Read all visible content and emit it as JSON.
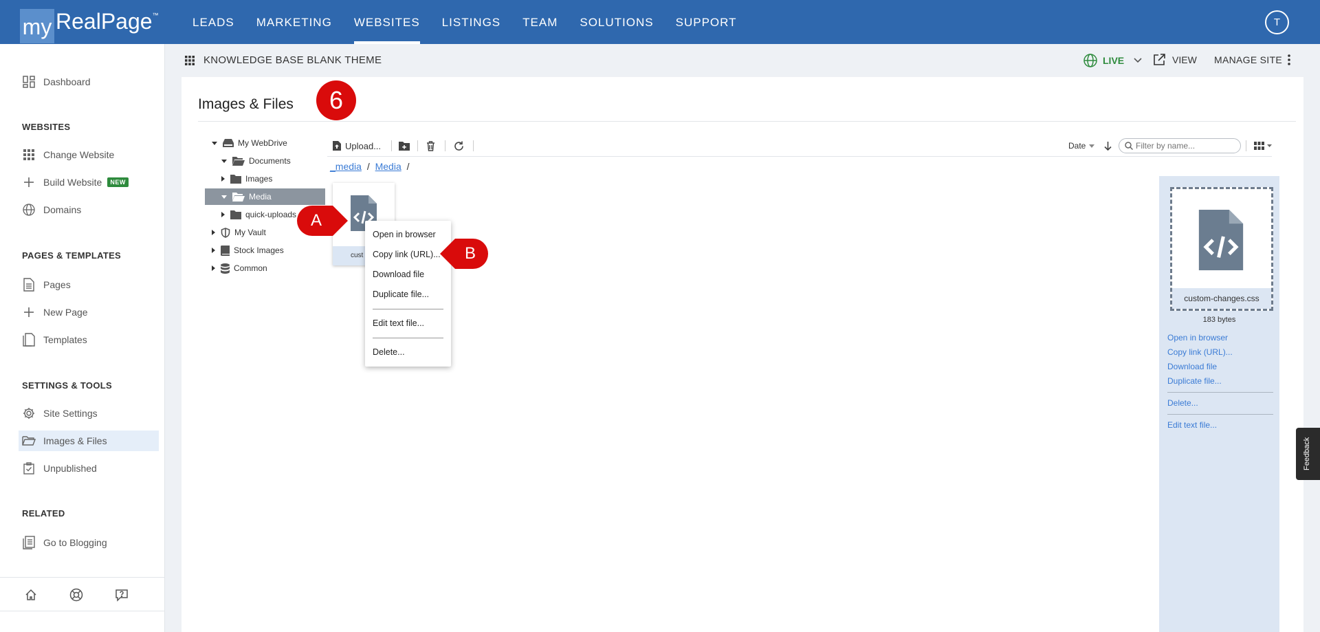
{
  "brand": {
    "logo_my": "my",
    "logo_rest": "RealPage",
    "logo_tm": "™"
  },
  "nav": {
    "items": [
      "LEADS",
      "MARKETING",
      "WEBSITES",
      "LISTINGS",
      "TEAM",
      "SOLUTIONS",
      "SUPPORT"
    ],
    "active": "WEBSITES",
    "avatar_initial": "T"
  },
  "sidebar": {
    "dashboard": "Dashboard",
    "sections": {
      "websites": "WEBSITES",
      "pages_templates": "PAGES & TEMPLATES",
      "settings_tools": "SETTINGS & TOOLS",
      "related": "RELATED"
    },
    "items": {
      "change_website": "Change Website",
      "build_website": "Build Website",
      "build_badge": "NEW",
      "domains": "Domains",
      "pages": "Pages",
      "new_page": "New Page",
      "templates": "Templates",
      "site_settings": "Site Settings",
      "images_files": "Images & Files",
      "unpublished": "Unpublished",
      "go_to_blogging": "Go to Blogging"
    }
  },
  "subheader": {
    "site_name": "KNOWLEDGE BASE BLANK THEME",
    "live": "LIVE",
    "view": "VIEW",
    "manage_site": "MANAGE SITE"
  },
  "page": {
    "title": "Images & Files",
    "step": "6"
  },
  "tree": {
    "my_webdrive": "My WebDrive",
    "documents": "Documents",
    "images": "Images",
    "media": "Media",
    "quick_uploads": "quick-uploads",
    "my_vault": "My Vault",
    "stock_images": "Stock Images",
    "common": "Common"
  },
  "toolbar": {
    "upload": "Upload...",
    "sort_label": "Date",
    "filter_placeholder": "Filter by name..."
  },
  "breadcrumb": {
    "root": "_media",
    "child": "Media",
    "sep": "/"
  },
  "file_tile": {
    "label": "cust"
  },
  "markers": {
    "a": "A",
    "b": "B"
  },
  "context_menu": {
    "open_in_browser": "Open in browser",
    "copy_link": "Copy link (URL)...",
    "download_file": "Download file",
    "duplicate_file": "Duplicate file...",
    "edit_text_file": "Edit text file...",
    "delete": "Delete..."
  },
  "details": {
    "file_name": "custom-changes.css",
    "size": "183 bytes",
    "open_in_browser": "Open in browser",
    "copy_link": "Copy link (URL)...",
    "download_file": "Download file",
    "duplicate_file": "Duplicate file...",
    "delete": "Delete...",
    "edit_text_file": "Edit text file..."
  },
  "feedback": "Feedback",
  "colors": {
    "nav_blue": "#2f68ae",
    "live_green": "#2e8b3d",
    "marker_red": "#d90b0b",
    "link_blue": "#3a7bd5"
  }
}
